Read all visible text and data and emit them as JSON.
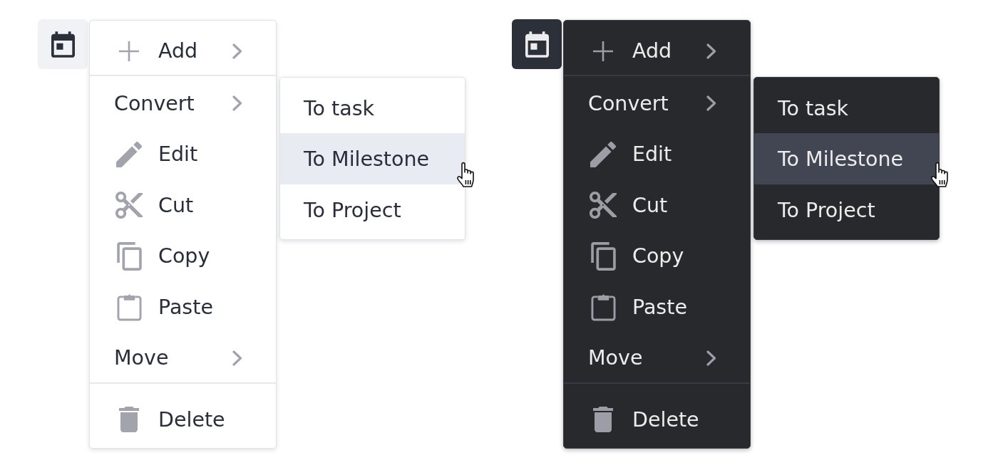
{
  "panels": [
    {
      "kind": "light",
      "menu": {
        "sections": [
          {
            "items": [
              {
                "kind": "command",
                "label": "Add",
                "submenu": true
              }
            ]
          },
          {
            "items": [
              {
                "kind": "group",
                "label": "Convert",
                "submenu": true,
                "children": [
                  {
                    "label": "To task",
                    "selected": false
                  },
                  {
                    "label": "To Milestone",
                    "selected": true
                  },
                  {
                    "label": "To Project",
                    "selected": false
                  }
                ]
              },
              {
                "kind": "command",
                "label": "Edit",
                "submenu": false
              },
              {
                "kind": "command",
                "label": "Cut",
                "submenu": false
              },
              {
                "kind": "command",
                "label": "Copy",
                "submenu": false
              },
              {
                "kind": "command",
                "label": "Paste",
                "submenu": false
              },
              {
                "kind": "group",
                "label": "Move",
                "submenu": true
              }
            ]
          },
          {
            "items": [
              {
                "kind": "command",
                "label": "Delete",
                "submenu": false
              }
            ]
          }
        ]
      }
    },
    {
      "kind": "dark",
      "menu": {
        "sections": [
          {
            "items": [
              {
                "kind": "command",
                "label": "Add",
                "submenu": true
              }
            ]
          },
          {
            "items": [
              {
                "kind": "group",
                "label": "Convert",
                "submenu": true,
                "children": [
                  {
                    "label": "To task",
                    "selected": false
                  },
                  {
                    "label": "To Milestone",
                    "selected": true
                  },
                  {
                    "label": "To Project",
                    "selected": false
                  }
                ]
              },
              {
                "kind": "command",
                "label": "Edit",
                "submenu": false
              },
              {
                "kind": "command",
                "label": "Cut",
                "submenu": false
              },
              {
                "kind": "command",
                "label": "Copy",
                "submenu": false
              },
              {
                "kind": "command",
                "label": "Paste",
                "submenu": false
              },
              {
                "kind": "group",
                "label": "Move",
                "submenu": true
              }
            ]
          },
          {
            "items": [
              {
                "kind": "command",
                "label": "Delete",
                "submenu": false
              }
            ]
          }
        ]
      }
    }
  ]
}
